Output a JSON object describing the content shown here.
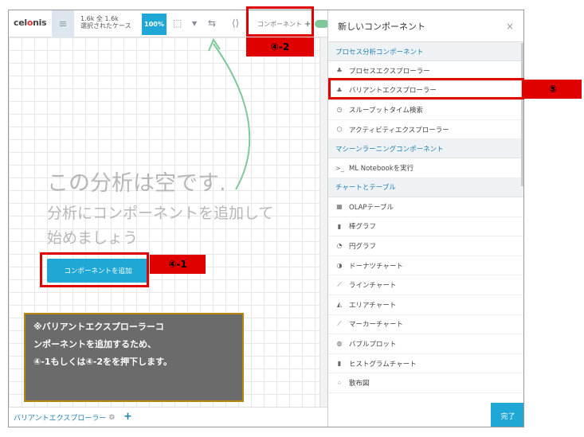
{
  "toolbar": {
    "logo_prefix": "cel",
    "logo_o": "o",
    "logo_suffix": "nis",
    "case_line1": "1.6k 全 1.6k",
    "case_line2": "選択されたケース",
    "percent": "100%",
    "component_label": "コンポーネント"
  },
  "canvas": {
    "empty_title": "この分析は空です.",
    "empty_sub": "分析にコンポーネントを追加して始めましょう",
    "add_button": "コンポーネントを追加"
  },
  "bottom": {
    "sheet_tab": "バリアントエクスプローラー"
  },
  "panel": {
    "title": "新しいコンポーネント",
    "close": "×",
    "done": "完了",
    "sections": [
      {
        "title": "プロセス分析コンポーネント",
        "items": [
          {
            "label": "プロセスエクスプローラー",
            "icon": "hierarchy-icon"
          },
          {
            "label": "バリアントエクスプローラー",
            "icon": "hierarchy-icon"
          },
          {
            "label": "スループットタイム検索",
            "icon": "clock-icon"
          },
          {
            "label": "アクティビティエクスプローラー",
            "icon": "hexagon-icon"
          }
        ]
      },
      {
        "title": "マシーンラーニングコンポーネント",
        "items": [
          {
            "label": "ML Notebookを実行",
            "icon": "terminal-icon"
          }
        ]
      },
      {
        "title": "チャートとテーブル",
        "items": [
          {
            "label": "OLAPテーブル",
            "icon": "table-icon"
          },
          {
            "label": "棒グラフ",
            "icon": "bar-chart-icon"
          },
          {
            "label": "円グラフ",
            "icon": "pie-chart-icon"
          },
          {
            "label": "ドーナツチャート",
            "icon": "donut-chart-icon"
          },
          {
            "label": "ラインチャート",
            "icon": "line-chart-icon"
          },
          {
            "label": "エリアチャート",
            "icon": "area-chart-icon"
          },
          {
            "label": "マーカーチャート",
            "icon": "marker-chart-icon"
          },
          {
            "label": "バブルプロット",
            "icon": "bubble-icon"
          },
          {
            "label": "ヒストグラムチャート",
            "icon": "histogram-icon"
          },
          {
            "label": "散布図",
            "icon": "scatter-icon"
          }
        ]
      }
    ]
  },
  "annotations": {
    "label_4_2": "④-2",
    "label_4_1": "④-1",
    "label_5": "⑤",
    "note_lines": [
      "※バリアントエクスプローラーコ",
      "ンポーネントを追加するため、",
      "④-1もしくは④-2をを押下します。"
    ]
  },
  "colors": {
    "accent": "#1fa8d6",
    "highlight": "#e00000",
    "note_bg": "#6b6b6b",
    "arrow": "#7fc89a"
  }
}
